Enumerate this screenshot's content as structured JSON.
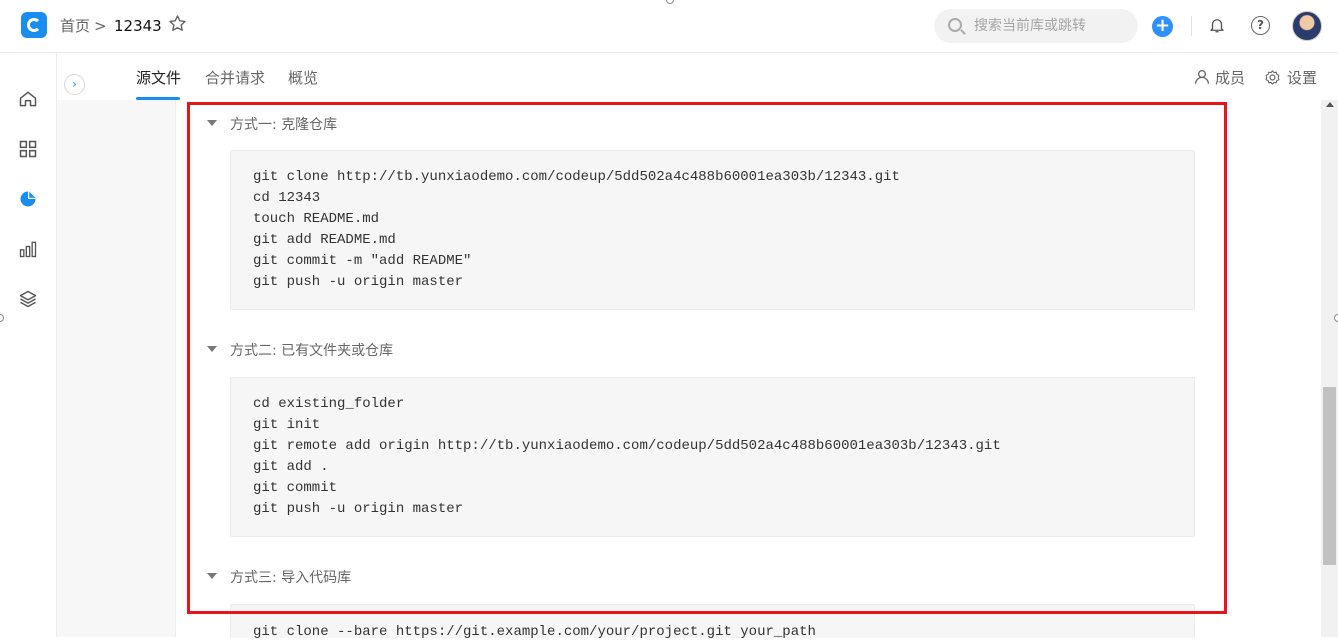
{
  "header": {
    "breadcrumb_home": "首页",
    "breadcrumb_separator": ">",
    "breadcrumb_current": "12343",
    "search_placeholder": "搜索当前库或跳转",
    "add_label": "+",
    "help_label": "?"
  },
  "tabs": {
    "items": [
      "源文件",
      "合并请求",
      "概览"
    ],
    "active": "源文件",
    "members_label": "成员",
    "settings_label": "设置"
  },
  "sections": [
    {
      "title": "方式一: 克隆仓库",
      "lines": [
        "git clone http://tb.yunxiaodemo.com/codeup/5dd502a4c488b60001ea303b/12343.git",
        "cd 12343",
        "touch README.md",
        "git add README.md",
        "git commit -m \"add README\"",
        "git push -u origin master"
      ]
    },
    {
      "title": "方式二: 已有文件夹或仓库",
      "lines": [
        "cd existing_folder",
        "git init",
        "git remote add origin http://tb.yunxiaodemo.com/codeup/5dd502a4c488b60001ea303b/12343.git",
        "git add .",
        "git commit",
        "git push -u origin master"
      ]
    },
    {
      "title": "方式三: 导入代码库",
      "lines": [
        "git clone --bare https://git.example.com/your/project.git your_path"
      ]
    }
  ],
  "colors": {
    "accent": "#1b8cf2",
    "highlight": "#e8141b"
  },
  "icons": [
    "home-icon",
    "grid-icon",
    "pie-chart-icon",
    "bar-chart-icon",
    "layers-icon",
    "star-icon",
    "search-icon",
    "bell-icon",
    "help-icon",
    "user-icon",
    "gear-icon"
  ]
}
